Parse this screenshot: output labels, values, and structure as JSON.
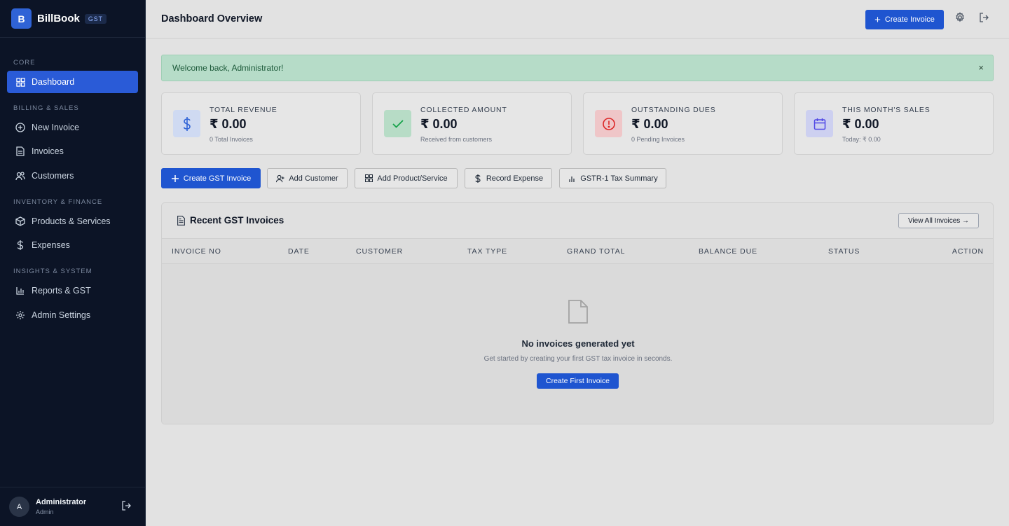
{
  "sidebar": {
    "brand": {
      "logo_letter": "B",
      "name": "BillBook",
      "badge": "GST"
    },
    "sections": [
      {
        "label": "CORE"
      },
      {
        "label": "BILLING & SALES"
      },
      {
        "label": "INVENTORY & FINANCE"
      },
      {
        "label": "INSIGHTS & SYSTEM"
      }
    ],
    "items": [
      {
        "label": "Dashboard",
        "icon": "grid-icon",
        "active": true
      },
      {
        "label": "New Invoice",
        "icon": "plus-circle-icon"
      },
      {
        "label": "Invoices",
        "icon": "document-icon"
      },
      {
        "label": "Customers",
        "icon": "users-icon"
      },
      {
        "label": "Products & Services",
        "icon": "box-icon"
      },
      {
        "label": "Expenses",
        "icon": "dollar-icon"
      },
      {
        "label": "Reports & GST",
        "icon": "bar-chart-icon"
      },
      {
        "label": "Admin Settings",
        "icon": "gear-icon"
      }
    ],
    "user": {
      "initial": "A",
      "name": "Administrator",
      "role": "Admin"
    }
  },
  "header": {
    "title": "Dashboard Overview",
    "create_invoice_label": "Create Invoice"
  },
  "alert": {
    "message": "Welcome back, Administrator!",
    "close": "×"
  },
  "stats": [
    {
      "label": "TOTAL REVENUE",
      "value": "₹ 0.00",
      "sub": "0 Total Invoices",
      "icon": "dollar-icon",
      "color": "#2f63d6"
    },
    {
      "label": "COLLECTED AMOUNT",
      "value": "₹ 0.00",
      "sub": "Received from customers",
      "icon": "check-icon",
      "color": "#16a34a"
    },
    {
      "label": "OUTSTANDING DUES",
      "value": "₹ 0.00",
      "sub": "0 Pending Invoices",
      "icon": "alert-icon",
      "color": "#dc2626"
    },
    {
      "label": "THIS MONTH'S SALES",
      "value": "₹ 0.00",
      "sub": "Today: ₹ 0.00",
      "icon": "calendar-icon",
      "color": "#4f46e5"
    }
  ],
  "actions": [
    {
      "label": "Create GST Invoice",
      "icon": "plus-icon"
    },
    {
      "label": "Add Customer",
      "icon": "user-plus-icon"
    },
    {
      "label": "Add Product/Service",
      "icon": "grid-icon"
    },
    {
      "label": "Record Expense",
      "icon": "dollar-icon"
    },
    {
      "label": "GSTR-1 Tax Summary",
      "icon": "bar-chart-icon"
    }
  ],
  "recent": {
    "title": "Recent GST Invoices",
    "view_all": "View All Invoices →",
    "columns": [
      "INVOICE NO",
      "DATE",
      "CUSTOMER",
      "TAX TYPE",
      "GRAND TOTAL",
      "BALANCE DUE",
      "STATUS",
      "ACTION"
    ],
    "empty_title": "No invoices generated yet",
    "empty_sub": "Get started by creating your first GST tax invoice in seconds.",
    "empty_button": "Create First Invoice"
  }
}
